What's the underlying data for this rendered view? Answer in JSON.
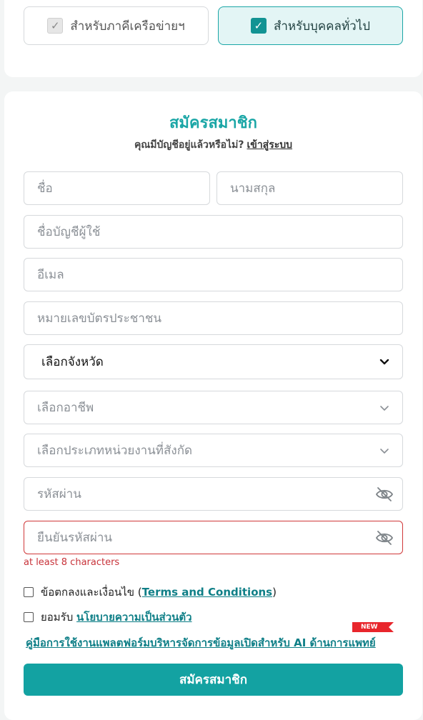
{
  "user_type": {
    "partner_label": "สำหรับภาคีเครือข่ายฯ",
    "public_label": "สำหรับบุคคลทั่วไป",
    "selected": "public"
  },
  "form": {
    "title": "สมัครสมาชิก",
    "subtitle_text": "คุณมีบัญชีอยู่แล้วหรือไม่?",
    "login_link": "เข้าสู่ระบบ",
    "first_name_placeholder": "ชื่อ",
    "last_name_placeholder": "นามสกุล",
    "username_placeholder": "ชื่อบัญชีผู้ใช้",
    "email_placeholder": "อีเมล",
    "id_card_placeholder": "หมายเลขบัตรประชาชน",
    "province_value": "เลือกจังหวัด",
    "occupation_placeholder": "เลือกอาชีพ",
    "agency_type_placeholder": "เลือกประเภทหน่วยงานที่สังกัด",
    "password_placeholder": "รหัสผ่าน",
    "confirm_password_placeholder": "ยืนยันรหัสผ่าน",
    "password_error": "at least 8 characters",
    "terms_prefix": "ข้อตกลงและเงื่อนไข (",
    "terms_link": "Terms and Conditions",
    "terms_suffix": ")",
    "privacy_prefix": "ยอมรับ",
    "privacy_link": "นโยบายความเป็นส่วนตัว",
    "guide_link": "คู่มือการใช้งานแพลตฟอร์มบริหารจัดการข้อมูลเปิดสำหรับ AI ด้านการแพทย์",
    "new_badge": "NEW",
    "submit_label": "สมัครสมาชิก"
  },
  "colors": {
    "accent": "#13a2a2",
    "error": "#d0393a",
    "link": "#0f7f87",
    "badge": "#e8262c"
  }
}
